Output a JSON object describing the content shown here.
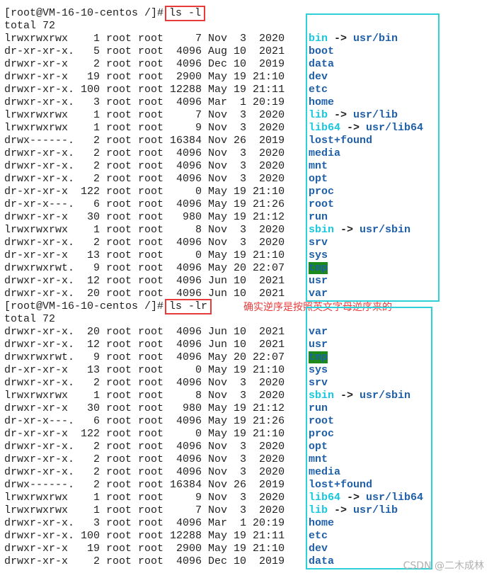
{
  "prompt1": "[root@VM-16-10-centos /]#",
  "cmd1": "ls -l",
  "total1": "total 72",
  "prompt2": "[root@VM-16-10-centos /]#",
  "cmd2": "ls -lr",
  "total2": "total 72",
  "annotation": "确实逆序是按照英文字母逆序来的",
  "watermark": "CSDN @二木成林",
  "colors": {
    "highlight_box": "#2fd1d9",
    "command_box": "#e83b3b",
    "dir": "#1f5fa8",
    "link": "#18c7e0",
    "tmp_bg": "#1b8a1b"
  },
  "listing1": [
    {
      "perm": "lrwxrwxrwx ",
      "links": "  1",
      "owner": "root",
      "group": "root",
      "size": "    7",
      "month": "Nov",
      "day": " 3",
      "time": " 2020",
      "name": "bin",
      "link": "usr/bin",
      "type": "link"
    },
    {
      "perm": "dr-xr-xr-x.",
      "links": "  5",
      "owner": "root",
      "group": "root",
      "size": " 4096",
      "month": "Aug",
      "day": "10",
      "time": " 2021",
      "name": "boot",
      "type": "dir"
    },
    {
      "perm": "drwxr-xr-x ",
      "links": "  2",
      "owner": "root",
      "group": "root",
      "size": " 4096",
      "month": "Dec",
      "day": "10",
      "time": " 2019",
      "name": "data",
      "type": "dir"
    },
    {
      "perm": "drwxr-xr-x ",
      "links": " 19",
      "owner": "root",
      "group": "root",
      "size": " 2900",
      "month": "May",
      "day": "19",
      "time": "21:10",
      "name": "dev",
      "type": "dir"
    },
    {
      "perm": "drwxr-xr-x.",
      "links": "100",
      "owner": "root",
      "group": "root",
      "size": "12288",
      "month": "May",
      "day": "19",
      "time": "21:11",
      "name": "etc",
      "type": "dir"
    },
    {
      "perm": "drwxr-xr-x.",
      "links": "  3",
      "owner": "root",
      "group": "root",
      "size": " 4096",
      "month": "Mar",
      "day": " 1",
      "time": "20:19",
      "name": "home",
      "type": "dir"
    },
    {
      "perm": "lrwxrwxrwx ",
      "links": "  1",
      "owner": "root",
      "group": "root",
      "size": "    7",
      "month": "Nov",
      "day": " 3",
      "time": " 2020",
      "name": "lib",
      "link": "usr/lib",
      "type": "link"
    },
    {
      "perm": "lrwxrwxrwx ",
      "links": "  1",
      "owner": "root",
      "group": "root",
      "size": "    9",
      "month": "Nov",
      "day": " 3",
      "time": " 2020",
      "name": "lib64",
      "link": "usr/lib64",
      "type": "link"
    },
    {
      "perm": "drwx------.",
      "links": "  2",
      "owner": "root",
      "group": "root",
      "size": "16384",
      "month": "Nov",
      "day": "26",
      "time": " 2019",
      "name": "lost+found",
      "type": "dir"
    },
    {
      "perm": "drwxr-xr-x.",
      "links": "  2",
      "owner": "root",
      "group": "root",
      "size": " 4096",
      "month": "Nov",
      "day": " 3",
      "time": " 2020",
      "name": "media",
      "type": "dir"
    },
    {
      "perm": "drwxr-xr-x.",
      "links": "  2",
      "owner": "root",
      "group": "root",
      "size": " 4096",
      "month": "Nov",
      "day": " 3",
      "time": " 2020",
      "name": "mnt",
      "type": "dir"
    },
    {
      "perm": "drwxr-xr-x.",
      "links": "  2",
      "owner": "root",
      "group": "root",
      "size": " 4096",
      "month": "Nov",
      "day": " 3",
      "time": " 2020",
      "name": "opt",
      "type": "dir"
    },
    {
      "perm": "dr-xr-xr-x ",
      "links": "122",
      "owner": "root",
      "group": "root",
      "size": "    0",
      "month": "May",
      "day": "19",
      "time": "21:10",
      "name": "proc",
      "type": "dir"
    },
    {
      "perm": "dr-xr-x---.",
      "links": "  6",
      "owner": "root",
      "group": "root",
      "size": " 4096",
      "month": "May",
      "day": "19",
      "time": "21:26",
      "name": "root",
      "type": "dir"
    },
    {
      "perm": "drwxr-xr-x ",
      "links": " 30",
      "owner": "root",
      "group": "root",
      "size": "  980",
      "month": "May",
      "day": "19",
      "time": "21:12",
      "name": "run",
      "type": "dir"
    },
    {
      "perm": "lrwxrwxrwx ",
      "links": "  1",
      "owner": "root",
      "group": "root",
      "size": "    8",
      "month": "Nov",
      "day": " 3",
      "time": " 2020",
      "name": "sbin",
      "link": "usr/sbin",
      "type": "link"
    },
    {
      "perm": "drwxr-xr-x.",
      "links": "  2",
      "owner": "root",
      "group": "root",
      "size": " 4096",
      "month": "Nov",
      "day": " 3",
      "time": " 2020",
      "name": "srv",
      "type": "dir"
    },
    {
      "perm": "dr-xr-xr-x ",
      "links": " 13",
      "owner": "root",
      "group": "root",
      "size": "    0",
      "month": "May",
      "day": "19",
      "time": "21:10",
      "name": "sys",
      "type": "dir"
    },
    {
      "perm": "drwxrwxrwt.",
      "links": "  9",
      "owner": "root",
      "group": "root",
      "size": " 4096",
      "month": "May",
      "day": "20",
      "time": "22:07",
      "name": "tmp",
      "type": "tmp"
    },
    {
      "perm": "drwxr-xr-x.",
      "links": " 12",
      "owner": "root",
      "group": "root",
      "size": " 4096",
      "month": "Jun",
      "day": "10",
      "time": " 2021",
      "name": "usr",
      "type": "dir"
    },
    {
      "perm": "drwxr-xr-x.",
      "links": " 20",
      "owner": "root",
      "group": "root",
      "size": " 4096",
      "month": "Jun",
      "day": "10",
      "time": " 2021",
      "name": "var",
      "type": "dir"
    }
  ],
  "listing2": [
    {
      "perm": "drwxr-xr-x.",
      "links": " 20",
      "owner": "root",
      "group": "root",
      "size": " 4096",
      "month": "Jun",
      "day": "10",
      "time": " 2021",
      "name": "var",
      "type": "dir"
    },
    {
      "perm": "drwxr-xr-x.",
      "links": " 12",
      "owner": "root",
      "group": "root",
      "size": " 4096",
      "month": "Jun",
      "day": "10",
      "time": " 2021",
      "name": "usr",
      "type": "dir"
    },
    {
      "perm": "drwxrwxrwt.",
      "links": "  9",
      "owner": "root",
      "group": "root",
      "size": " 4096",
      "month": "May",
      "day": "20",
      "time": "22:07",
      "name": "tmp",
      "type": "tmp"
    },
    {
      "perm": "dr-xr-xr-x ",
      "links": " 13",
      "owner": "root",
      "group": "root",
      "size": "    0",
      "month": "May",
      "day": "19",
      "time": "21:10",
      "name": "sys",
      "type": "dir"
    },
    {
      "perm": "drwxr-xr-x.",
      "links": "  2",
      "owner": "root",
      "group": "root",
      "size": " 4096",
      "month": "Nov",
      "day": " 3",
      "time": " 2020",
      "name": "srv",
      "type": "dir"
    },
    {
      "perm": "lrwxrwxrwx ",
      "links": "  1",
      "owner": "root",
      "group": "root",
      "size": "    8",
      "month": "Nov",
      "day": " 3",
      "time": " 2020",
      "name": "sbin",
      "link": "usr/sbin",
      "type": "link"
    },
    {
      "perm": "drwxr-xr-x ",
      "links": " 30",
      "owner": "root",
      "group": "root",
      "size": "  980",
      "month": "May",
      "day": "19",
      "time": "21:12",
      "name": "run",
      "type": "dir"
    },
    {
      "perm": "dr-xr-x---.",
      "links": "  6",
      "owner": "root",
      "group": "root",
      "size": " 4096",
      "month": "May",
      "day": "19",
      "time": "21:26",
      "name": "root",
      "type": "dir"
    },
    {
      "perm": "dr-xr-xr-x ",
      "links": "122",
      "owner": "root",
      "group": "root",
      "size": "    0",
      "month": "May",
      "day": "19",
      "time": "21:10",
      "name": "proc",
      "type": "dir"
    },
    {
      "perm": "drwxr-xr-x.",
      "links": "  2",
      "owner": "root",
      "group": "root",
      "size": " 4096",
      "month": "Nov",
      "day": " 3",
      "time": " 2020",
      "name": "opt",
      "type": "dir"
    },
    {
      "perm": "drwxr-xr-x.",
      "links": "  2",
      "owner": "root",
      "group": "root",
      "size": " 4096",
      "month": "Nov",
      "day": " 3",
      "time": " 2020",
      "name": "mnt",
      "type": "dir"
    },
    {
      "perm": "drwxr-xr-x.",
      "links": "  2",
      "owner": "root",
      "group": "root",
      "size": " 4096",
      "month": "Nov",
      "day": " 3",
      "time": " 2020",
      "name": "media",
      "type": "dir"
    },
    {
      "perm": "drwx------.",
      "links": "  2",
      "owner": "root",
      "group": "root",
      "size": "16384",
      "month": "Nov",
      "day": "26",
      "time": " 2019",
      "name": "lost+found",
      "type": "dir"
    },
    {
      "perm": "lrwxrwxrwx ",
      "links": "  1",
      "owner": "root",
      "group": "root",
      "size": "    9",
      "month": "Nov",
      "day": " 3",
      "time": " 2020",
      "name": "lib64",
      "link": "usr/lib64",
      "type": "link"
    },
    {
      "perm": "lrwxrwxrwx ",
      "links": "  1",
      "owner": "root",
      "group": "root",
      "size": "    7",
      "month": "Nov",
      "day": " 3",
      "time": " 2020",
      "name": "lib",
      "link": "usr/lib",
      "type": "link"
    },
    {
      "perm": "drwxr-xr-x.",
      "links": "  3",
      "owner": "root",
      "group": "root",
      "size": " 4096",
      "month": "Mar",
      "day": " 1",
      "time": "20:19",
      "name": "home",
      "type": "dir"
    },
    {
      "perm": "drwxr-xr-x.",
      "links": "100",
      "owner": "root",
      "group": "root",
      "size": "12288",
      "month": "May",
      "day": "19",
      "time": "21:11",
      "name": "etc",
      "type": "dir"
    },
    {
      "perm": "drwxr-xr-x ",
      "links": " 19",
      "owner": "root",
      "group": "root",
      "size": " 2900",
      "month": "May",
      "day": "19",
      "time": "21:10",
      "name": "dev",
      "type": "dir"
    },
    {
      "perm": "drwxr-xr-x ",
      "links": "  2",
      "owner": "root",
      "group": "root",
      "size": " 4096",
      "month": "Dec",
      "day": "10",
      "time": " 2019",
      "name": "data",
      "type": "dir"
    }
  ]
}
